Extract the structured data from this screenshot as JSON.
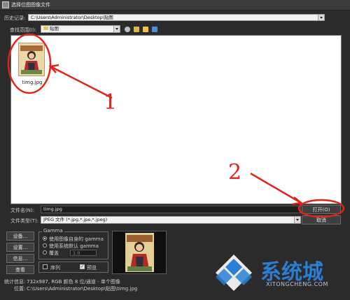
{
  "window": {
    "title": "选择位图图像文件"
  },
  "history": {
    "label": "历史记录:",
    "value": "C:\\Users\\Administrator\\Desktop\\贴图"
  },
  "lookin": {
    "label": "查找范围(I):",
    "value": "贴图"
  },
  "files": [
    {
      "name": "timg.jpg"
    }
  ],
  "filename": {
    "label": "文件名(N):",
    "value": "timg.jpg"
  },
  "filetype": {
    "label": "文件类型(T):",
    "value": "JPEG 文件 (*.jpg,*.jpe,*.jpeg)"
  },
  "buttons": {
    "open": "打开(O)",
    "cancel": "取消",
    "setup": "设备...",
    "settings": "设置...",
    "info": "信息...",
    "view": "查看"
  },
  "gamma": {
    "title": "Gamma",
    "opt_image": "使用图像自身的 gamma",
    "opt_system": "使用系统默认 gamma",
    "opt_override": "覆盖",
    "override_value": "1.0",
    "selected": "opt_image"
  },
  "checks": {
    "sequence": "序列",
    "preview": "预览",
    "preview_checked": true,
    "sequence_checked": false
  },
  "stats": {
    "label": "统计信息:",
    "value": "732x987, RGB 颜色 8 位/通道 - 单个图像",
    "location_label": "位置:",
    "location_value": "C:\\Users\\Administrator\\Desktop\\贴图\\timg.jpg"
  },
  "annotations": {
    "mark1": "1",
    "mark2": "2",
    "color": "#e2231a"
  },
  "watermark": {
    "brand": "系统城",
    "url": "XITONGCHENG.COM",
    "color": "#2a7fd4"
  }
}
